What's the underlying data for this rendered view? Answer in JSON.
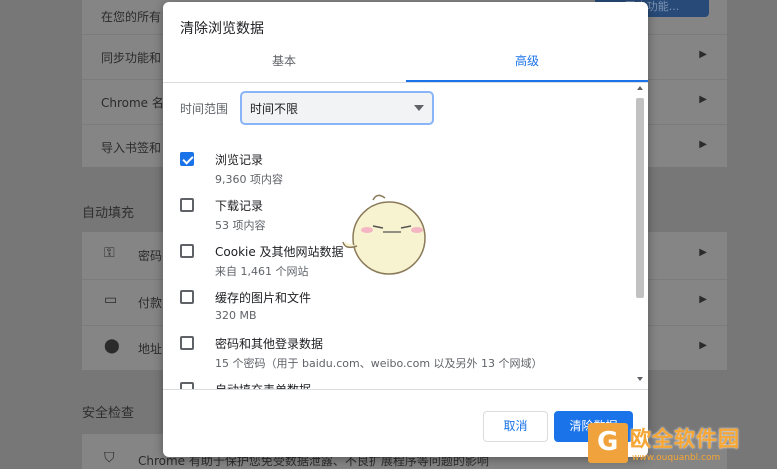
{
  "background": {
    "top_row": "在您的所有",
    "top_button": "同步功能...",
    "rows": [
      {
        "label": "同步功能和",
        "icon": ""
      },
      {
        "label": "Chrome 名",
        "icon": ""
      },
      {
        "label": "导入书签和",
        "icon": ""
      }
    ],
    "section_autofill": "自动填充",
    "autofill_rows": [
      {
        "label": "密码",
        "icon": "key-icon"
      },
      {
        "label": "付款",
        "icon": "credit-card-icon"
      },
      {
        "label": "地址",
        "icon": "location-pin-icon"
      }
    ],
    "section_safety": "安全检查",
    "safety_row": "Chrome 有助于保护您免受数据泄露、不良扩展程序等问题的影响"
  },
  "dialog": {
    "title": "清除浏览数据",
    "tabs": [
      {
        "label": "基本",
        "active": false
      },
      {
        "label": "高级",
        "active": true
      }
    ],
    "time_range": {
      "label": "时间范围",
      "value": "时间不限"
    },
    "items": [
      {
        "title": "浏览记录",
        "subtitle": "9,360 项内容",
        "checked": true
      },
      {
        "title": "下载记录",
        "subtitle": "53 项内容",
        "checked": false
      },
      {
        "title": "Cookie 及其他网站数据",
        "subtitle": "来自 1,461 个网站",
        "checked": false
      },
      {
        "title": "缓存的图片和文件",
        "subtitle": "320 MB",
        "checked": false
      },
      {
        "title": "密码和其他登录数据",
        "subtitle": "15 个密码（用于 baidu.com、weibo.com 以及另外 13 个网域）",
        "checked": false
      },
      {
        "title": "自动填充表单数据",
        "subtitle": "",
        "checked": false
      }
    ],
    "cancel_label": "取消",
    "clear_label": "清除数据"
  },
  "watermark": {
    "text": "欧全软件园",
    "url": "www.ouquanbl.com"
  },
  "colors": {
    "accent": "#1a73e8",
    "overlay": "#777777"
  }
}
